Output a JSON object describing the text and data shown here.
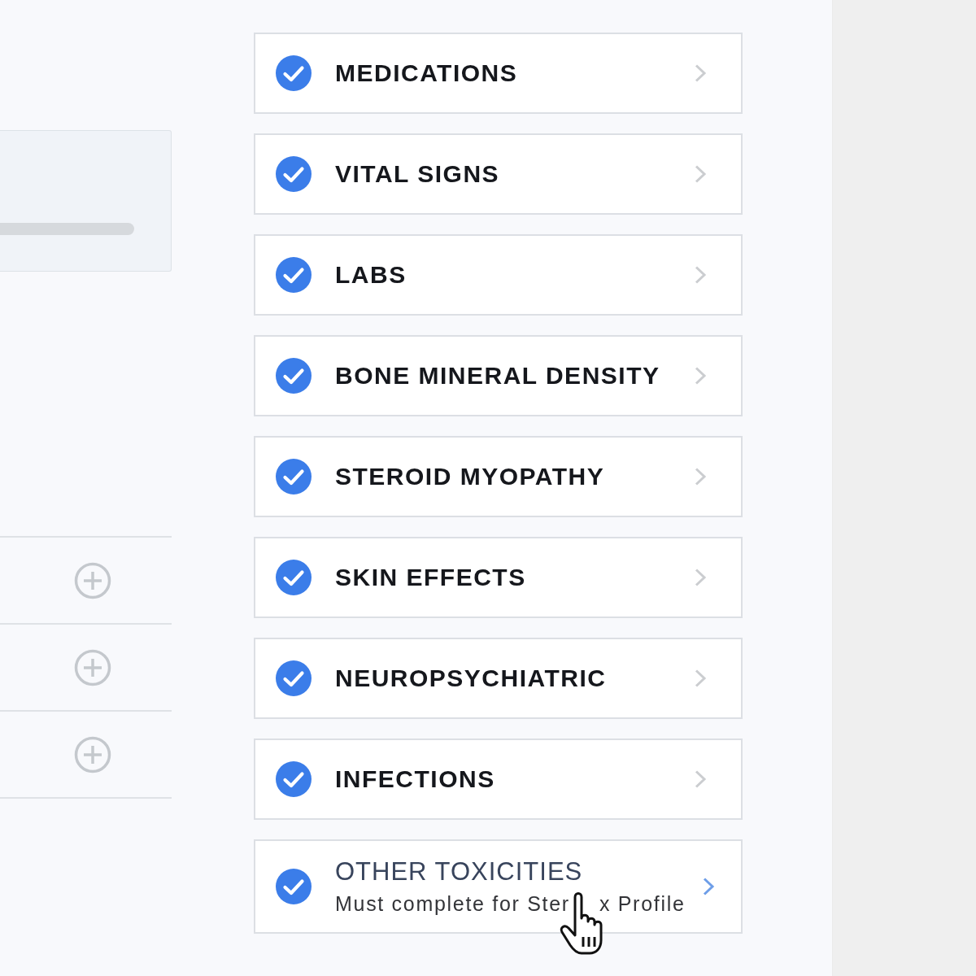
{
  "left_panel": {
    "rows": [
      {
        "kind": "add"
      },
      {
        "kind": "add"
      },
      {
        "kind": "add"
      }
    ]
  },
  "sections": [
    {
      "title": "MEDICATIONS",
      "checked": true,
      "hovered": false
    },
    {
      "title": "VITAL SIGNS",
      "checked": true,
      "hovered": false
    },
    {
      "title": "LABS",
      "checked": true,
      "hovered": false
    },
    {
      "title": "BONE MINERAL DENSITY",
      "checked": true,
      "hovered": false
    },
    {
      "title": "STEROID MYOPATHY",
      "checked": true,
      "hovered": false
    },
    {
      "title": "SKIN EFFECTS",
      "checked": true,
      "hovered": false
    },
    {
      "title": "NEUROPSYCHIATRIC",
      "checked": true,
      "hovered": false
    },
    {
      "title": "INFECTIONS",
      "checked": true,
      "hovered": false
    },
    {
      "title": "OTHER TOXICITIES",
      "subtitle": [
        "Must complete for Ster",
        "x Profile"
      ],
      "checked": true,
      "hovered": true
    }
  ]
}
